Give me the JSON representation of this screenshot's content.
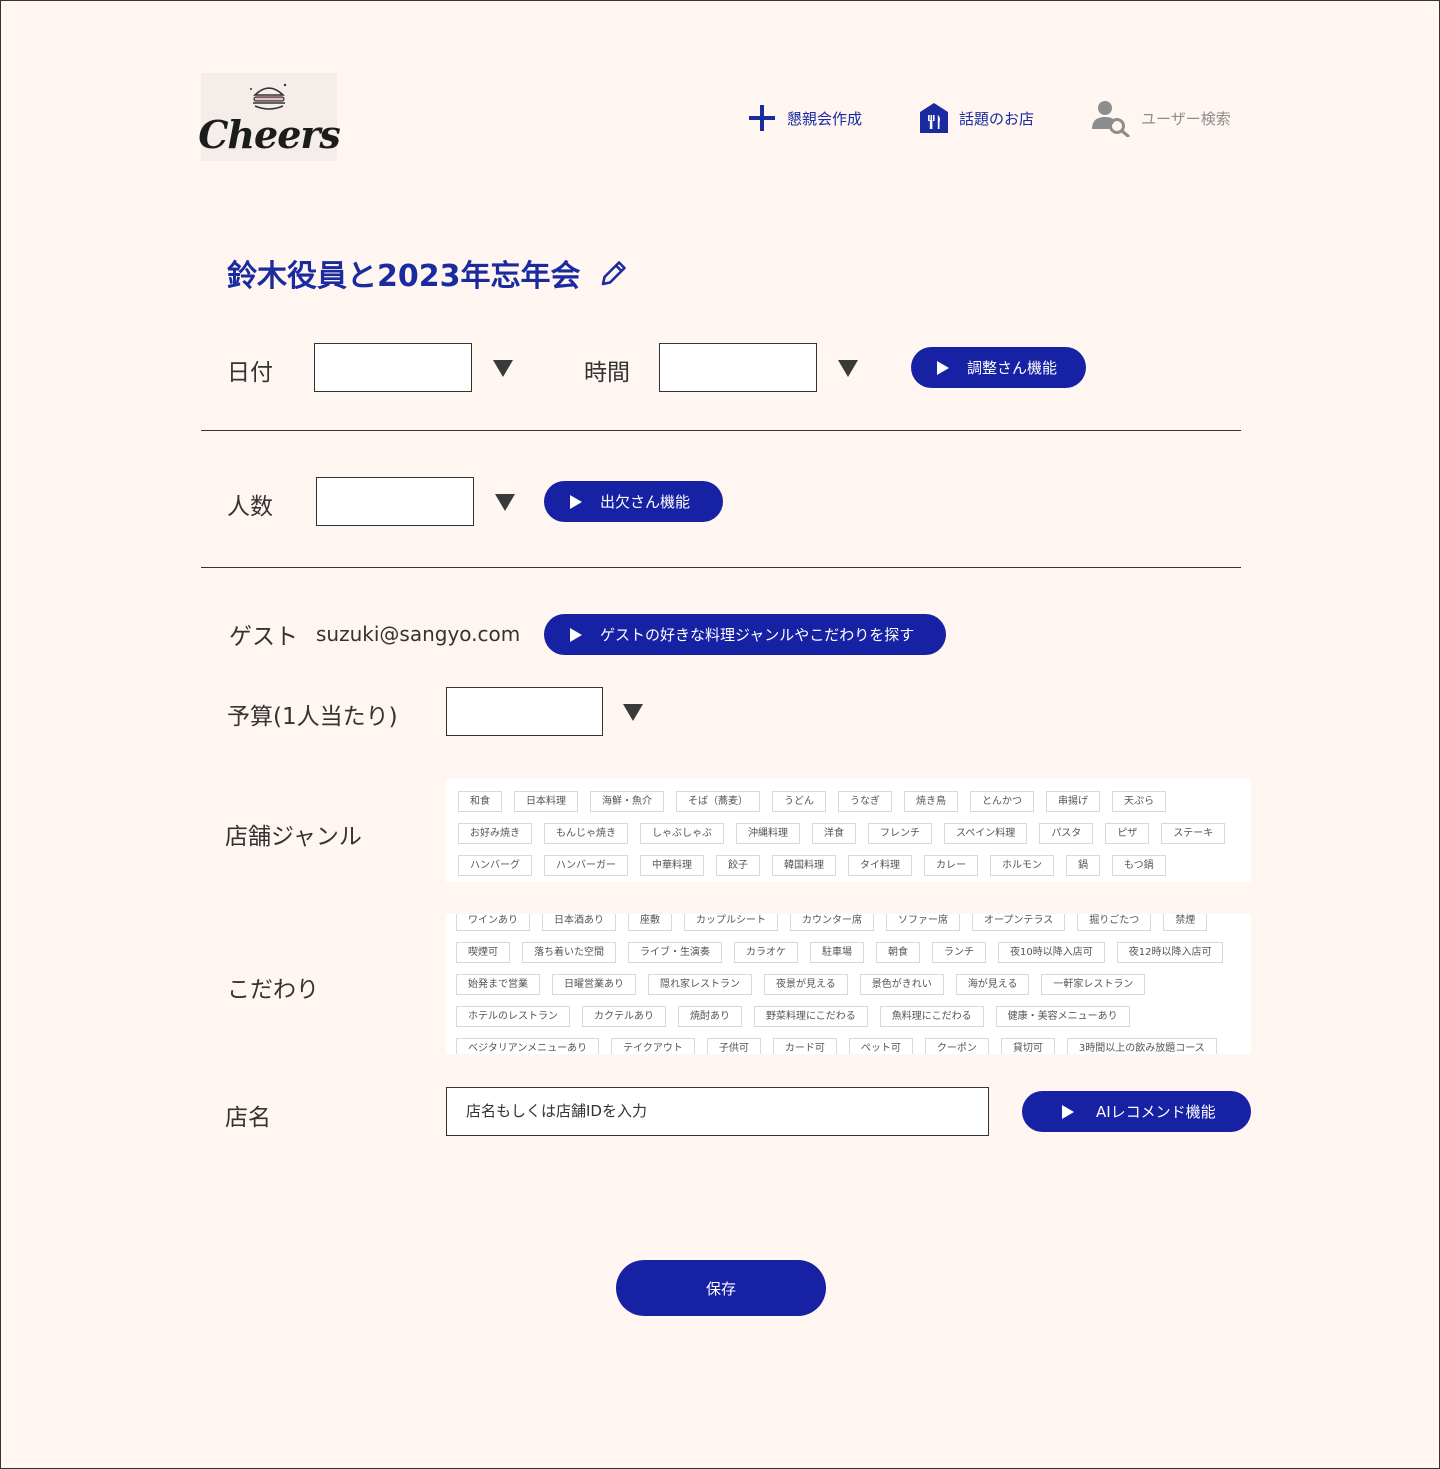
{
  "brand": {
    "logo_text": "Cheers"
  },
  "nav": [
    {
      "label": "懇親会作成",
      "icon": "plus-icon",
      "color": "#1a2ba0"
    },
    {
      "label": "話題のお店",
      "icon": "restaurant-icon",
      "color": "#1a2ba0"
    },
    {
      "label": "ユーザー検索",
      "icon": "user-search-icon",
      "color": "#8d8d8d"
    }
  ],
  "event": {
    "title": "鈴木役員と2023年忘年会"
  },
  "form": {
    "date_label": "日付",
    "time_label": "時間",
    "schedule_button": "調整さん機能",
    "people_label": "人数",
    "attendance_button": "出欠さん機能",
    "guest_label": "ゲスト",
    "guest_email": "suzuki@sangyo.com",
    "guest_pref_button": "ゲストの好きな料理ジャンルやこだわりを探す",
    "budget_label": "予算(1人当たり)",
    "genre_label": "店舗ジャンル",
    "pref_label": "こだわり",
    "shop_label": "店名",
    "shop_placeholder": "店名もしくは店舗IDを入力",
    "ai_button": "AIレコメンド機能",
    "save_button": "保存"
  },
  "genres": [
    [
      "和食",
      "日本料理",
      "海鮮・魚介",
      "そば（蕎麦）",
      "うどん",
      "うなぎ",
      "焼き鳥",
      "とんかつ",
      "串揚げ",
      "天ぷら"
    ],
    [
      "お好み焼き",
      "もんじゃ焼き",
      "しゃぶしゃぶ",
      "沖縄料理",
      "洋食",
      "フレンチ",
      "スペイン料理",
      "パスタ",
      "ピザ",
      "ステーキ"
    ],
    [
      "ハンバーグ",
      "ハンバーガー",
      "中華料理",
      "餃子",
      "韓国料理",
      "タイ料理",
      "カレー",
      "ホルモン",
      "鍋",
      "もつ鍋"
    ]
  ],
  "preferences": [
    [
      "ワインあり",
      "日本酒あり",
      "座敷",
      "カップルシート",
      "カウンター席",
      "ソファー席",
      "オープンテラス",
      "掘りごたつ",
      "禁煙"
    ],
    [
      "喫煙可",
      "落ち着いた空間",
      "ライブ・生演奏",
      "カラオケ",
      "駐車場",
      "朝食",
      "ランチ",
      "夜10時以降入店可",
      "夜12時以降入店可"
    ],
    [
      "始発まで営業",
      "日曜営業あり",
      "隠れ家レストラン",
      "夜景が見える",
      "景色がきれい",
      "海が見える",
      "一軒家レストラン"
    ],
    [
      "ホテルのレストラン",
      "カクテルあり",
      "焼酎あり",
      "野菜料理にこだわる",
      "魚料理にこだわる",
      "健康・美容メニューあり"
    ],
    [
      "ベジタリアンメニューあり",
      "テイクアウト",
      "子供可",
      "カード可",
      "ペット可",
      "クーポン",
      "貸切可",
      "3時間以上の飲み放題コース"
    ]
  ]
}
